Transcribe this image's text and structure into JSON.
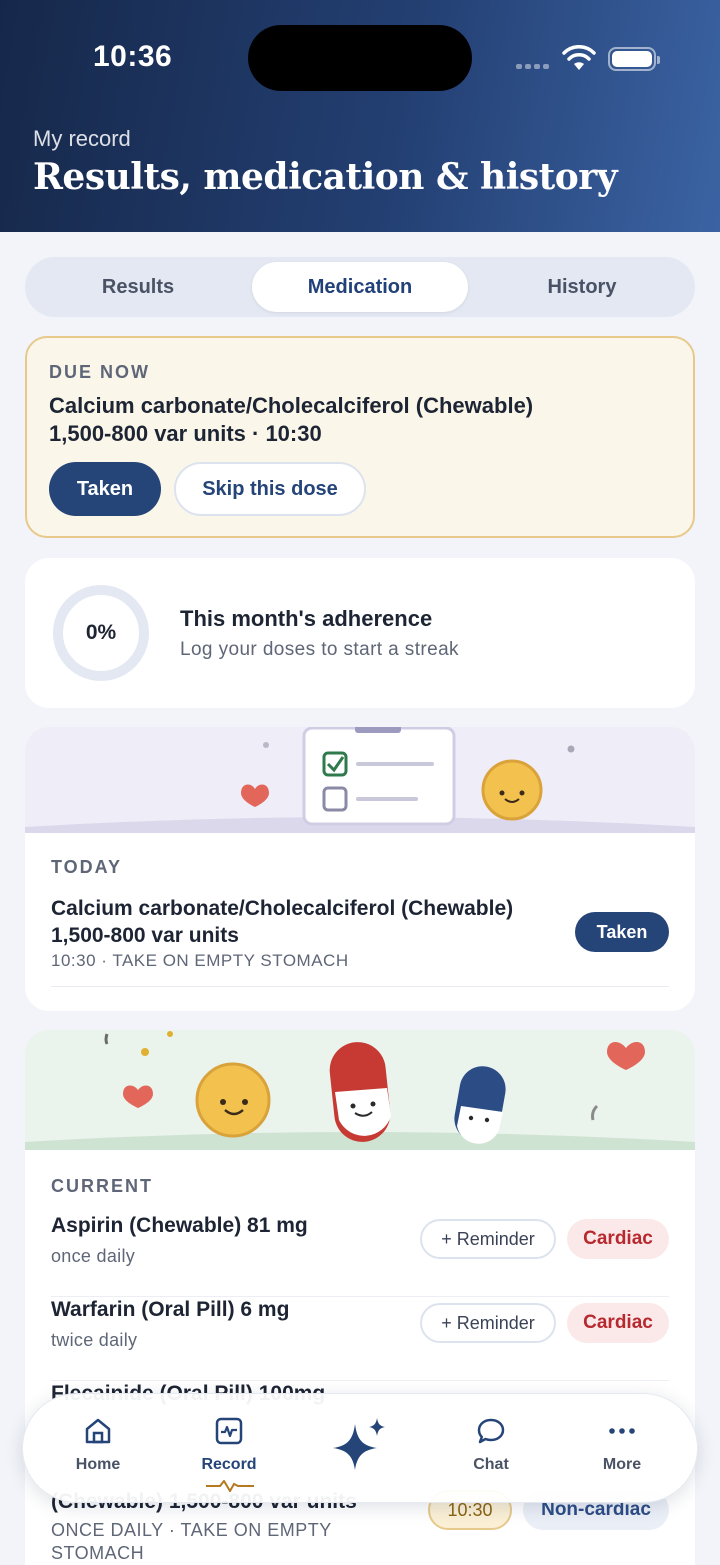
{
  "status_bar": {
    "time": "10:36"
  },
  "header": {
    "eyebrow": "My record",
    "title": "Results, medication & history"
  },
  "tabs": [
    {
      "label": "Results",
      "active": false
    },
    {
      "label": "Medication",
      "active": true
    },
    {
      "label": "History",
      "active": false
    }
  ],
  "due_now": {
    "label": "DUE NOW",
    "med_line1": "Calcium carbonate/Cholecalciferol (Chewable)",
    "med_line2": "1,500-800 var units · 10:30",
    "taken_label": "Taken",
    "skip_label": "Skip this dose"
  },
  "adherence": {
    "percent": "0%",
    "title": "This month's adherence",
    "subtitle": "Log your doses to start a streak"
  },
  "today": {
    "label": "TODAY",
    "med_line1": "Calcium carbonate/Cholecalciferol (Chewable)",
    "med_line2": "1,500-800 var units",
    "detail": "10:30 · TAKE ON EMPTY STOMACH",
    "status_label": "Taken"
  },
  "current": {
    "label": "CURRENT",
    "items": [
      {
        "name": "Aspirin (Chewable) 81 mg",
        "freq": "once daily",
        "reminder": "+ Reminder",
        "tag": "Cardiac"
      },
      {
        "name": "Warfarin (Oral Pill) 6 mg",
        "freq": "twice daily",
        "reminder": "+ Reminder",
        "tag": "Cardiac"
      },
      {
        "name": "Flecainide (Oral Pill) 100mg"
      }
    ],
    "partial_item": {
      "name_fragment": "(Chewable) 1,500-800 var units",
      "detail_line1": "ONCE DAILY · TAKE ON EMPTY",
      "detail_line2": "STOMACH",
      "time": "10:30",
      "tag": "Non-cardiac"
    }
  },
  "nav": [
    {
      "label": "Home",
      "icon": "home-icon",
      "active": false
    },
    {
      "label": "Record",
      "icon": "record-icon",
      "active": true
    },
    {
      "label": "",
      "icon": "sparkle-icon",
      "active": false
    },
    {
      "label": "Chat",
      "icon": "chat-icon",
      "active": false
    },
    {
      "label": "More",
      "icon": "more-icon",
      "active": false
    }
  ],
  "colors": {
    "primary": "#254578",
    "cardiac": "#b8292f",
    "due_bg": "#fbf6ea",
    "due_border": "#e6c98b"
  }
}
